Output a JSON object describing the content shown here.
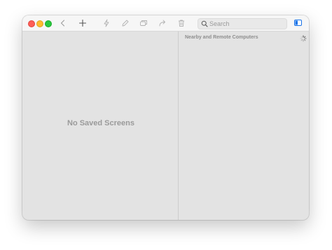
{
  "toolbar": {
    "back_icon": "chevron-left-icon",
    "add_icon": "plus-icon",
    "connect_icon": "lightning-icon",
    "edit_icon": "pencil-icon",
    "group_icon": "stacked-windows-icon",
    "share_icon": "share-arrow-icon",
    "delete_icon": "trash-icon",
    "search": {
      "placeholder": "Search",
      "value": ""
    },
    "sidebar_icon": "sidebar-toggle-icon"
  },
  "saved_screens": {
    "empty_text": "No Saved Screens"
  },
  "nearby": {
    "header": "Nearby and Remote Computers",
    "loading_icon": "spinner-icon"
  },
  "colors": {
    "close": "#fe5f57",
    "minimize": "#febc2e",
    "zoom": "#28c840",
    "accent": "#1a73e8"
  }
}
